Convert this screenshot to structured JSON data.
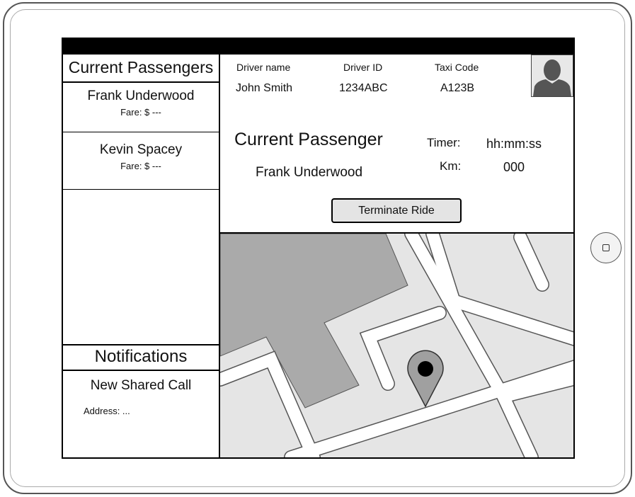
{
  "sidebar": {
    "title": "Current Passengers",
    "passengers": [
      {
        "name": "Frank Underwood",
        "fare": "Fare: $ ---"
      },
      {
        "name": "Kevin Spacey",
        "fare": "Fare: $ ---"
      }
    ]
  },
  "notifications": {
    "title": "Notifications",
    "item_title": "New Shared Call",
    "item_address": "Address: ..."
  },
  "driver": {
    "name_label": "Driver name",
    "name_value": "John Smith",
    "id_label": "Driver ID",
    "id_value": "1234ABC",
    "taxi_label": "Taxi Code",
    "taxi_value": "A123B",
    "avatar_icon": "user-avatar-icon"
  },
  "ride": {
    "title": "Current Passenger",
    "passenger_name": "Frank Underwood",
    "timer_label": "Timer:",
    "timer_value": "hh:mm:ss",
    "km_label": "Km:",
    "km_value": "000",
    "terminate_label": "Terminate Ride"
  },
  "map": {
    "marker_icon": "map-pin-icon",
    "colors": {
      "road": "#ffffff",
      "block": "#e5e5e5",
      "park": "#aaaaaa",
      "marker": "#a0a0a0"
    }
  }
}
